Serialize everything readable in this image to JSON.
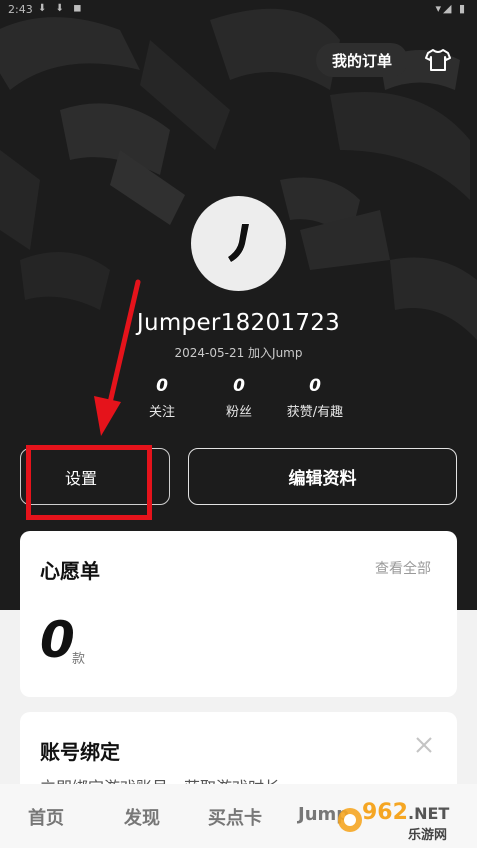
{
  "status_bar": {
    "time": "2:43",
    "left_icons": "⬇ ⬇ ◼",
    "right_icons": "▾◢ ▮"
  },
  "header": {
    "orders_label": "我的订单",
    "shirt_icon": "tshirt-icon"
  },
  "profile": {
    "avatar_glyph": "J",
    "username": "Jumper18201723",
    "joined": "2024-05-21 加入Jump",
    "stats": [
      {
        "value": "0",
        "label": "关注"
      },
      {
        "value": "0",
        "label": "粉丝"
      },
      {
        "value": "0",
        "label": "获赞/有趣"
      }
    ]
  },
  "actions": {
    "settings_label": "设置",
    "edit_label": "编辑资料"
  },
  "annotation": {
    "color": "#e5131b"
  },
  "wishlist": {
    "title": "心愿单",
    "view_all": "查看全部",
    "count": "0",
    "unit": "款"
  },
  "account_binding": {
    "title": "账号绑定",
    "description": "立即绑定游戏账号，获取游戏时长"
  },
  "tabbar": {
    "tabs": [
      {
        "label": "首页"
      },
      {
        "label": "发现"
      },
      {
        "label": "买点卡"
      },
      {
        "label": "Jump"
      }
    ]
  },
  "watermark": {
    "brand": "962",
    "suffix": ".NET",
    "subtitle": "乐游网"
  }
}
